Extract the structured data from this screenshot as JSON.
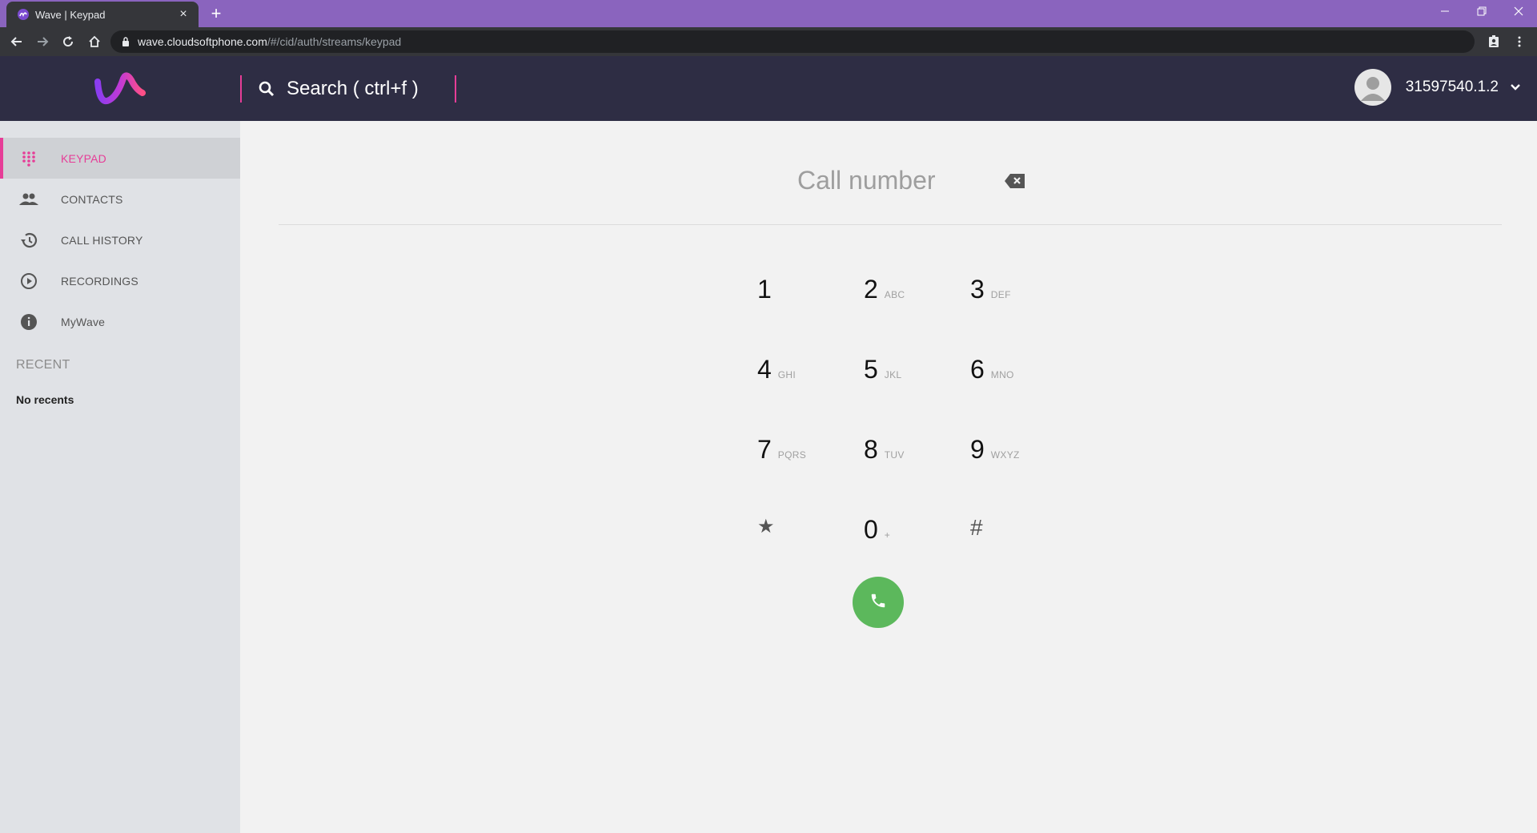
{
  "browser": {
    "tab_title": "Wave | Keypad",
    "tab_close": "×",
    "new_tab": "+",
    "url_domain": "wave.cloudsoftphone.com",
    "url_path": "/#/cid/auth/streams/keypad"
  },
  "header": {
    "search_label": "Search ( ctrl+f )",
    "username": "31597540.1.2"
  },
  "sidebar": {
    "items": [
      {
        "label": "KEYPAD",
        "icon": "dialpad-icon",
        "active": true
      },
      {
        "label": "CONTACTS",
        "icon": "people-icon",
        "active": false
      },
      {
        "label": "CALL HISTORY",
        "icon": "history-icon",
        "active": false
      },
      {
        "label": "RECORDINGS",
        "icon": "play-circle-icon",
        "active": false
      },
      {
        "label": "MyWave",
        "icon": "info-icon",
        "active": false
      }
    ],
    "recent_title": "RECENT",
    "recent_empty": "No recents"
  },
  "dialer": {
    "placeholder": "Call number",
    "keys": [
      {
        "digit": "1",
        "letters": ""
      },
      {
        "digit": "2",
        "letters": "ABC"
      },
      {
        "digit": "3",
        "letters": "DEF"
      },
      {
        "digit": "4",
        "letters": "GHI"
      },
      {
        "digit": "5",
        "letters": "JKL"
      },
      {
        "digit": "6",
        "letters": "MNO"
      },
      {
        "digit": "7",
        "letters": "PQRS"
      },
      {
        "digit": "8",
        "letters": "TUV"
      },
      {
        "digit": "9",
        "letters": "WXYZ"
      },
      {
        "digit": "★",
        "letters": ""
      },
      {
        "digit": "0",
        "letters": "+"
      },
      {
        "digit": "#",
        "letters": ""
      }
    ]
  },
  "colors": {
    "accent": "#e63d97",
    "header_bg": "#2e2d44",
    "tabbar_bg": "#8a64be",
    "call_green": "#5cb85c"
  }
}
